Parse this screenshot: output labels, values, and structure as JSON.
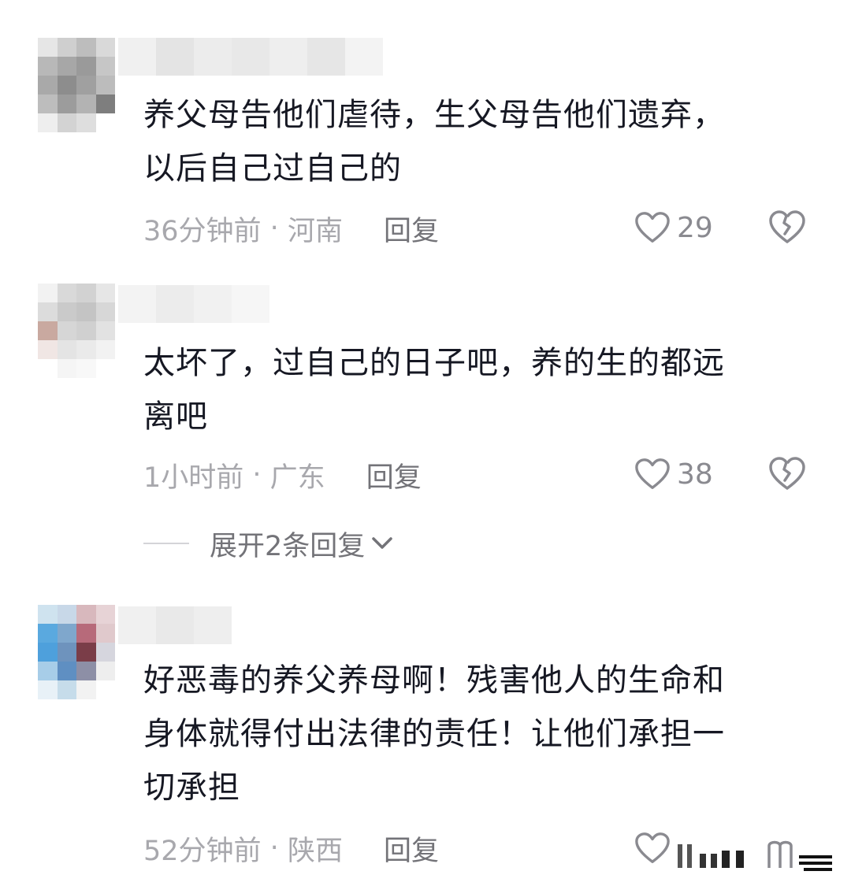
{
  "comments": [
    {
      "text_line1": "养父母告他们虐待，生父母告他们遗弃，",
      "text_line2": "以后自己过自己的",
      "time": "36分钟前",
      "location": "河南",
      "reply_label": "回复",
      "likes": "29"
    },
    {
      "text_line1": "太坏了，过自己的日子吧，养的生的都远",
      "text_line2": "离吧",
      "time": "1小时前",
      "location": "广东",
      "reply_label": "回复",
      "likes": "38",
      "expand_label": "展开2条回复"
    },
    {
      "text_line1": "好恶毒的养父养母啊！残害他人的生命和",
      "text_line2": "身体就得付出法律的责任！让他们承担一",
      "text_line3": "切承担",
      "time": "52分钟前",
      "location": "陕西",
      "reply_label": "回复"
    }
  ],
  "icons": {
    "like": "heart-outline-icon",
    "dislike": "broken-heart-icon",
    "expand": "chevron-down-icon"
  },
  "colors": {
    "text": "#161823",
    "meta": "#a8a8ad",
    "reply": "#737378"
  }
}
